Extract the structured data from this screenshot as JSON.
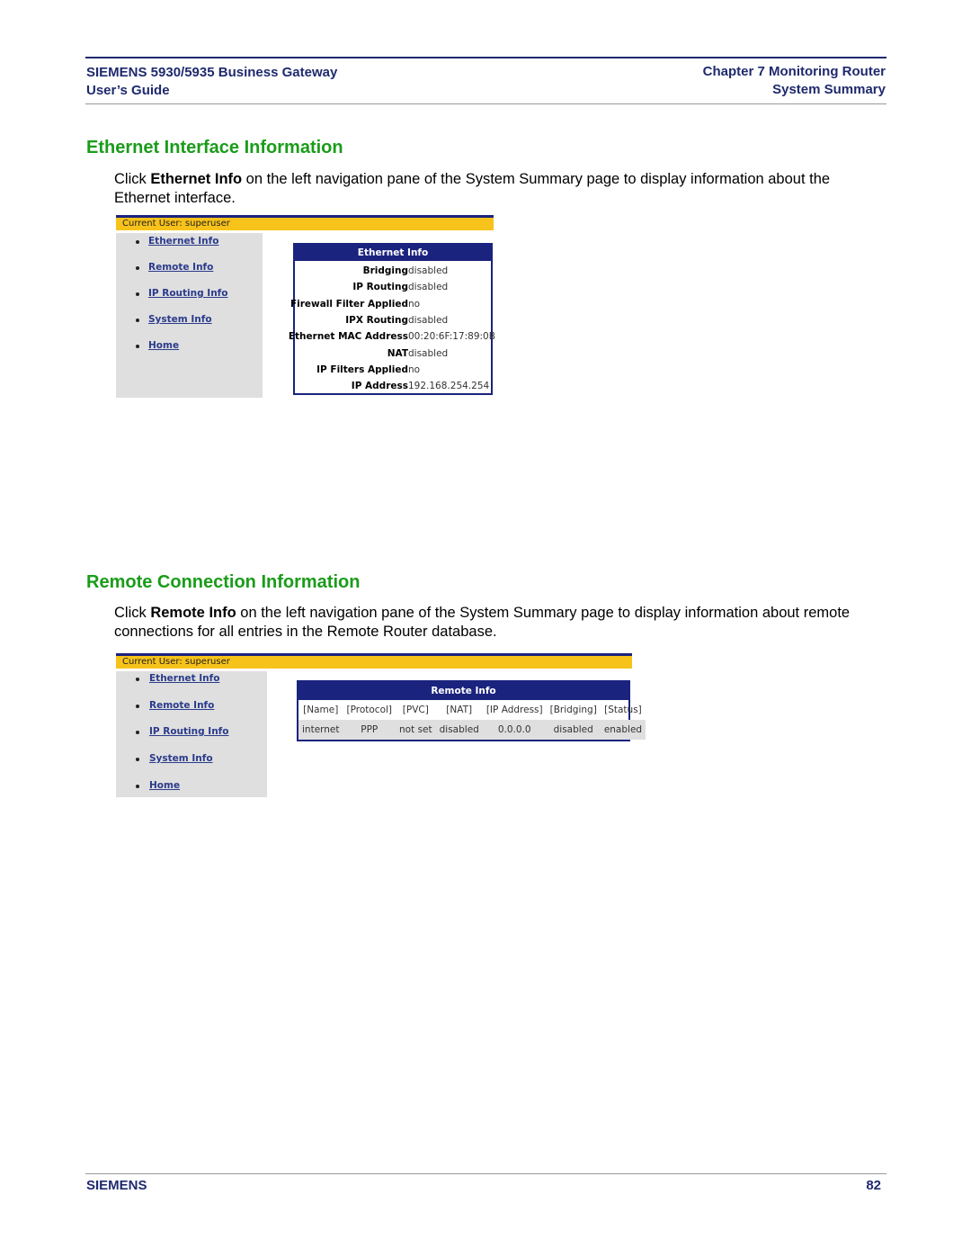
{
  "header": {
    "left_line1": "SIEMENS 5930/5935 Business Gateway",
    "left_line2": "User’s Guide",
    "right_line1": "Chapter 7  Monitoring Router",
    "right_line2": "System Summary"
  },
  "section1": {
    "title": "Ethernet Interface Information",
    "para_pre": "Click ",
    "para_bold": "Ethernet Info",
    "para_post": " on the left navigation pane of the System Summary page to display information about the Ethernet interface."
  },
  "section2": {
    "title": "Remote Connection Information",
    "para_pre": "Click ",
    "para_bold": "Remote Info",
    "para_post": " on the left navigation pane of the System Summary page to display information about remote connections for all entries in the Remote Router database."
  },
  "screenshot1": {
    "current_user": "Current User: superuser",
    "nav": [
      "Ethernet Info",
      "Remote Info",
      "IP Routing Info",
      "System Info",
      "Home"
    ],
    "panel_title": "Ethernet Info",
    "rows": [
      {
        "label": "Bridging",
        "value": "disabled"
      },
      {
        "label": "IP Routing",
        "value": "disabled"
      },
      {
        "label": "Firewall Filter Applied",
        "value": "no"
      },
      {
        "label": "IPX Routing",
        "value": "disabled"
      },
      {
        "label": "Ethernet MAC Address",
        "value": "00:20:6F:17:89:0B"
      },
      {
        "label": "NAT",
        "value": "disabled"
      },
      {
        "label": "IP Filters Applied",
        "value": "no"
      },
      {
        "label": "IP Address",
        "value": "192.168.254.254"
      }
    ]
  },
  "screenshot2": {
    "current_user": "Current User: superuser",
    "nav": [
      "Ethernet Info",
      "Remote Info",
      "IP Routing Info",
      "System Info",
      "Home"
    ],
    "panel_title": "Remote Info",
    "columns": [
      "[Name]",
      "[Protocol]",
      "[PVC]",
      "[NAT]",
      "[IP Address]",
      "[Bridging]",
      "[Status]"
    ],
    "rows": [
      [
        "internet",
        "PPP",
        "not set",
        "disabled",
        "0.0.0.0",
        "disabled",
        "enabled"
      ]
    ]
  },
  "footer": {
    "brand": "SIEMENS",
    "page_number": "82"
  },
  "colors": {
    "heading_green": "#1a9c1a",
    "navy": "#1a237e",
    "user_bar": "#f7c21a",
    "nav_bg": "#dfdfdf"
  }
}
